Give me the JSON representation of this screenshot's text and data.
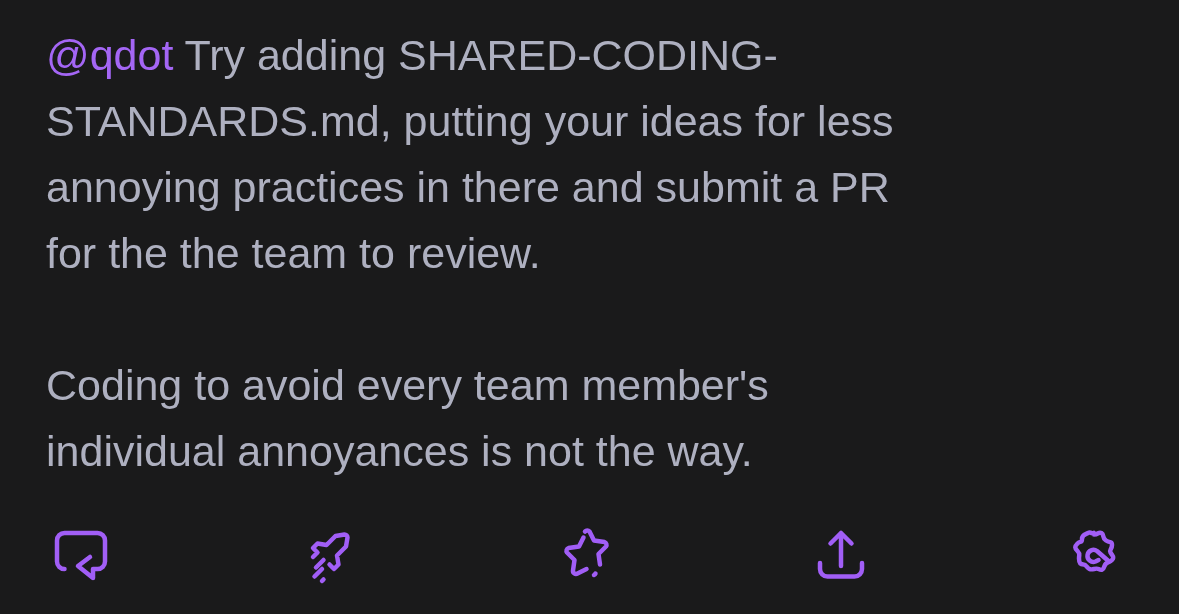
{
  "post": {
    "mention": "@qdot",
    "paragraphs": [
      "Try adding SHARED-CODING-\nSTANDARDS.md, putting your ideas for less\nannoying practices in there and submit a PR\nfor the the team to review.",
      "Coding to avoid every team member's\nindividual annoyances is not the way."
    ]
  },
  "actions": [
    {
      "kind": "reply"
    },
    {
      "kind": "boost"
    },
    {
      "kind": "favourite"
    },
    {
      "kind": "share"
    },
    {
      "kind": "more"
    }
  ]
}
